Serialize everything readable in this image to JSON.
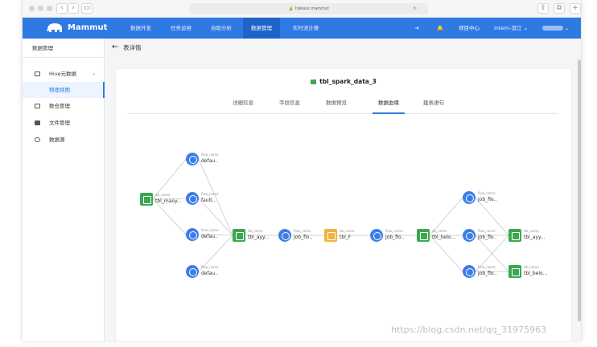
{
  "browser": {
    "url": "hdeasx.mammut"
  },
  "app": {
    "logo_text": "Mammut",
    "nav_items": [
      "数据开发",
      "任务运维",
      "自助分析",
      "数据管理",
      "实时流计算"
    ],
    "active_nav": "数据管理",
    "project_center": "项目中心",
    "user": "intern-滨江 ⌄",
    "brand_color": "#2f79e3"
  },
  "sidebar": {
    "header": "数据管理",
    "items": [
      {
        "label": "Hive元数据",
        "icon": "grid-icon"
      },
      {
        "label": "数仓管理",
        "icon": "grid-icon"
      },
      {
        "label": "文件管理",
        "icon": "file-icon"
      },
      {
        "label": "数据源",
        "icon": "database-icon"
      }
    ],
    "sub_item": "物理视图"
  },
  "page": {
    "title": "表详情",
    "table_name": "tbl_spark_data_3",
    "tabs": [
      "详细信息",
      "字段信息",
      "数据预览",
      "数据血缘",
      "建表语句"
    ],
    "active_tab": "数据血缘"
  },
  "graph": {
    "nodes": [
      {
        "id": "n1",
        "kind": "table",
        "type": "db_name",
        "label": "tbl_maoy..."
      },
      {
        "id": "n2",
        "kind": "job",
        "type": "flow_name",
        "label": "defau.."
      },
      {
        "id": "n3",
        "kind": "job",
        "type": "flow_name",
        "label": "fault.."
      },
      {
        "id": "n4",
        "kind": "job",
        "type": "flow_name",
        "label": "defau.."
      },
      {
        "id": "n5",
        "kind": "job",
        "type": "flow_name",
        "label": "defau.."
      },
      {
        "id": "n6",
        "kind": "table",
        "type": "db_name",
        "label": "tbl_ayy..."
      },
      {
        "id": "n7",
        "kind": "job",
        "type": "flow_name",
        "label": "job_flo.."
      },
      {
        "id": "n8",
        "kind": "tableY",
        "type": "db_name",
        "label": "tbl_F"
      },
      {
        "id": "n9",
        "kind": "job",
        "type": "flow_name",
        "label": "job_flo.."
      },
      {
        "id": "n10",
        "kind": "table",
        "type": "db_name",
        "label": "tbl_belo..."
      },
      {
        "id": "n11",
        "kind": "job",
        "type": "flow_name",
        "label": "job_flo.."
      },
      {
        "id": "n12",
        "kind": "job",
        "type": "flow_name",
        "label": "job_flo.."
      },
      {
        "id": "n13",
        "kind": "job",
        "type": "flow_name",
        "label": "job_flo.."
      },
      {
        "id": "n14",
        "kind": "table",
        "type": "db_name",
        "label": "tbl_ayy..."
      },
      {
        "id": "n15",
        "kind": "table",
        "type": "db_name",
        "label": "tbl_belo..."
      }
    ],
    "edges": [
      [
        "n1",
        "n2"
      ],
      [
        "n1",
        "n3"
      ],
      [
        "n1",
        "n4"
      ],
      [
        "n2",
        "n6"
      ],
      [
        "n3",
        "n6"
      ],
      [
        "n4",
        "n6"
      ],
      [
        "n5",
        "n6"
      ],
      [
        "n6",
        "n7"
      ],
      [
        "n7",
        "n8"
      ],
      [
        "n8",
        "n9"
      ],
      [
        "n9",
        "n10"
      ],
      [
        "n10",
        "n11"
      ],
      [
        "n10",
        "n12"
      ],
      [
        "n10",
        "n13"
      ],
      [
        "n11",
        "n14"
      ],
      [
        "n12",
        "n14"
      ],
      [
        "n12",
        "n15"
      ],
      [
        "n13",
        "n14"
      ],
      [
        "n13",
        "n15"
      ]
    ]
  },
  "watermark": "https://blog.csdn.net/qq_31975963"
}
